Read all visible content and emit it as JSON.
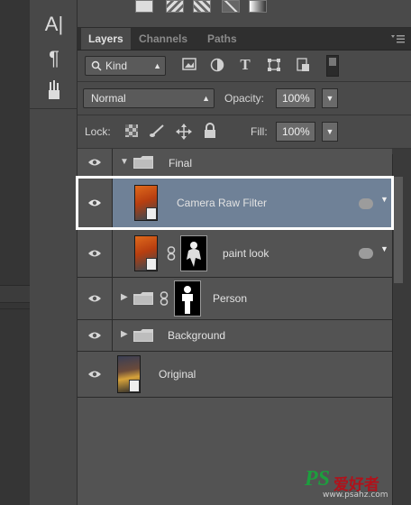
{
  "tabs": [
    {
      "label": "Layers",
      "active": true
    },
    {
      "label": "Channels",
      "active": false
    },
    {
      "label": "Paths",
      "active": false
    }
  ],
  "filter": {
    "kind_label": "Kind"
  },
  "blend": {
    "mode": "Normal",
    "opacity_label": "Opacity:",
    "opacity_value": "100%"
  },
  "lock": {
    "label": "Lock:",
    "fill_label": "Fill:",
    "fill_value": "100%"
  },
  "tool_glyphs": {
    "char": "A|",
    "para": "¶"
  },
  "layers": [
    {
      "name": "Final",
      "type": "group",
      "expanded": true,
      "visible": true
    },
    {
      "name": "Camera Raw Filter",
      "type": "smart-object",
      "selected": true,
      "visible": true
    },
    {
      "name": "paint look",
      "type": "smart-object-with-mask",
      "visible": true
    },
    {
      "name": "Person",
      "type": "group-with-mask",
      "expanded": false,
      "visible": true
    },
    {
      "name": "Background",
      "type": "group",
      "expanded": false,
      "visible": true
    },
    {
      "name": "Original",
      "type": "smart-object",
      "visible": true
    }
  ],
  "watermark": {
    "brand": "PS",
    "cn": "爱好者",
    "url": "www.psahz.com"
  },
  "colors": {
    "selected_row": "#6f8197",
    "accent_red": "#b0121b"
  }
}
